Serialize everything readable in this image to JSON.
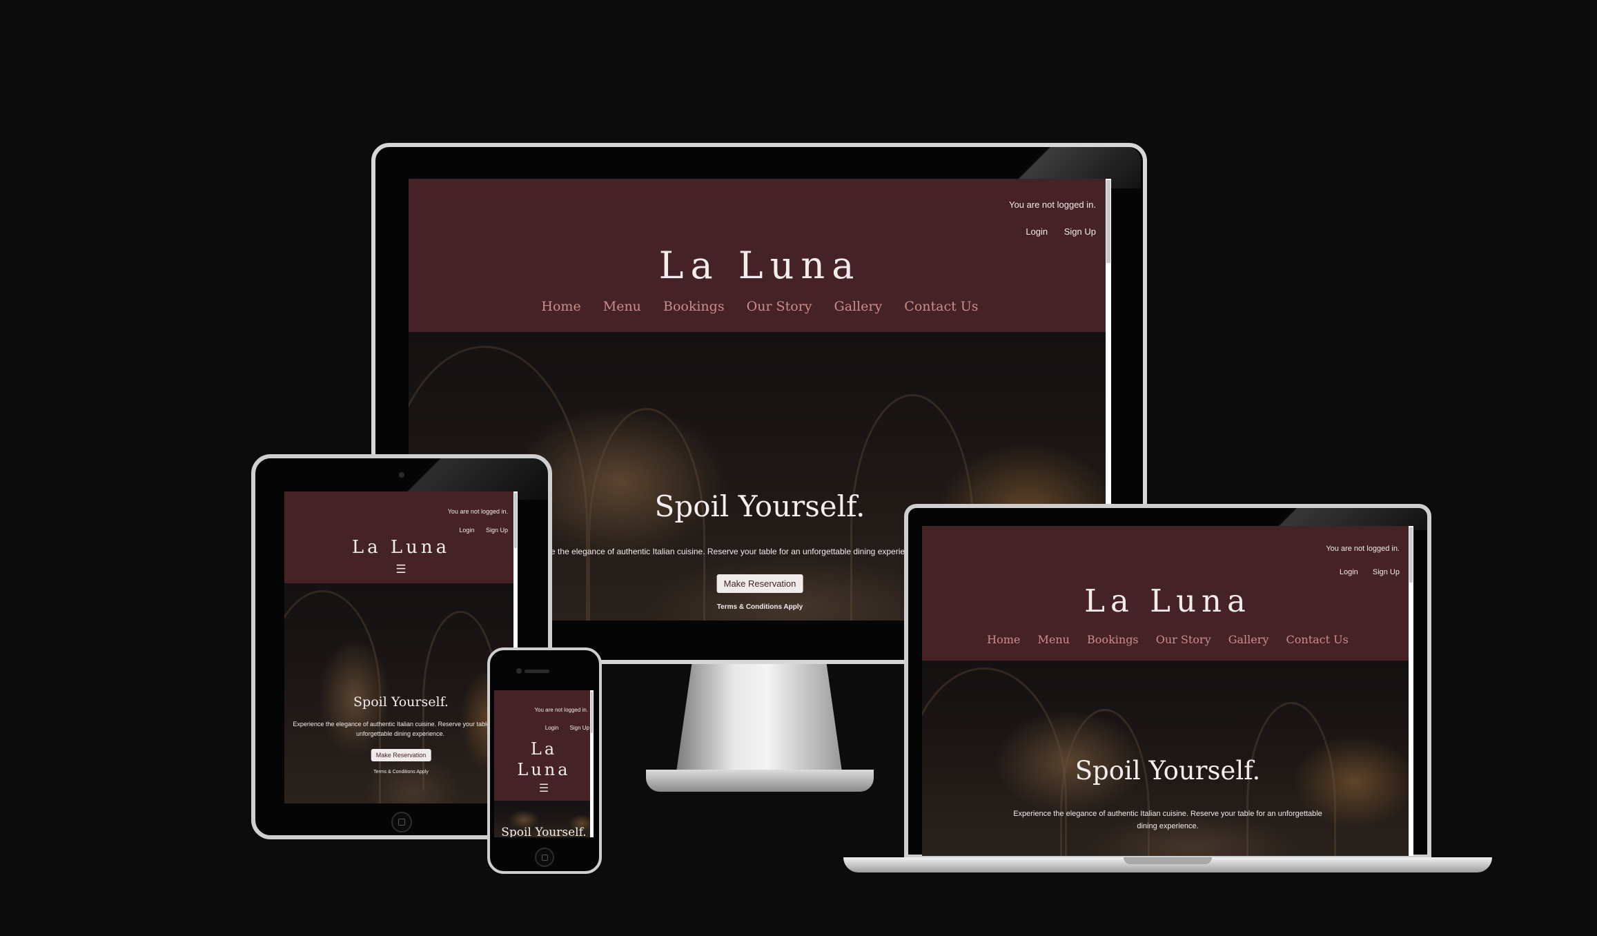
{
  "site": {
    "status_text": "You are not logged in.",
    "login_label": "Login",
    "signup_label": "Sign Up",
    "brand": "La Luna",
    "brand_line1": "La",
    "brand_line2": "Luna",
    "nav": [
      "Home",
      "Menu",
      "Bookings",
      "Our Story",
      "Gallery",
      "Contact Us"
    ],
    "menu_icon": "☰",
    "hero_title": "Spoil Yourself.",
    "hero_text": "Experience the elegance of authentic Italian cuisine. Reserve your table for an unforgettable dining experience.",
    "hero_button": "Make Reservation",
    "terms": "Terms & Conditions Apply"
  },
  "icons": {
    "menu": "hamburger-menu-icon",
    "home_button": "home-button-icon"
  },
  "colors": {
    "header": "#452226",
    "nav_link": "#c98e8e",
    "page_background": "#0d0c0d"
  }
}
